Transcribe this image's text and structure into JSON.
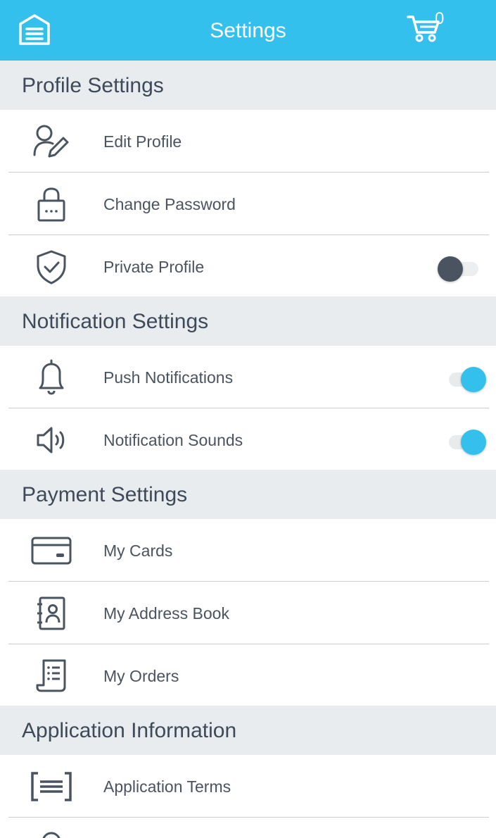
{
  "header": {
    "title": "Settings",
    "cart_count": "0",
    "menu_icon": "home-menu-icon",
    "cart_icon": "cart-icon",
    "color": "#33c0ed"
  },
  "sections": {
    "profile": "Profile Settings",
    "notification": "Notification Settings",
    "payment": "Payment Settings",
    "app_info": "Application Information"
  },
  "items": {
    "edit_profile": {
      "label": "Edit Profile",
      "icon": "user-edit-icon"
    },
    "change_password": {
      "label": "Change Password",
      "icon": "lock-icon"
    },
    "private_profile": {
      "label": "Private Profile",
      "icon": "shield-check-icon",
      "toggle": false
    },
    "push_notifications": {
      "label": "Push Notifications",
      "icon": "bell-icon",
      "toggle": true
    },
    "notification_sounds": {
      "label": "Notification Sounds",
      "icon": "speaker-icon",
      "toggle": true
    },
    "my_cards": {
      "label": "My Cards",
      "icon": "credit-card-icon"
    },
    "address_book": {
      "label": "My Address Book",
      "icon": "address-book-icon"
    },
    "my_orders": {
      "label": "My Orders",
      "icon": "receipt-icon"
    },
    "app_terms": {
      "label": "Application Terms",
      "icon": "terms-document-icon"
    }
  },
  "colors": {
    "accent": "#33c0ed",
    "section_bg": "#e9ecef",
    "text": "#3e4a59",
    "toggle_off_knob": "#4a5461"
  }
}
